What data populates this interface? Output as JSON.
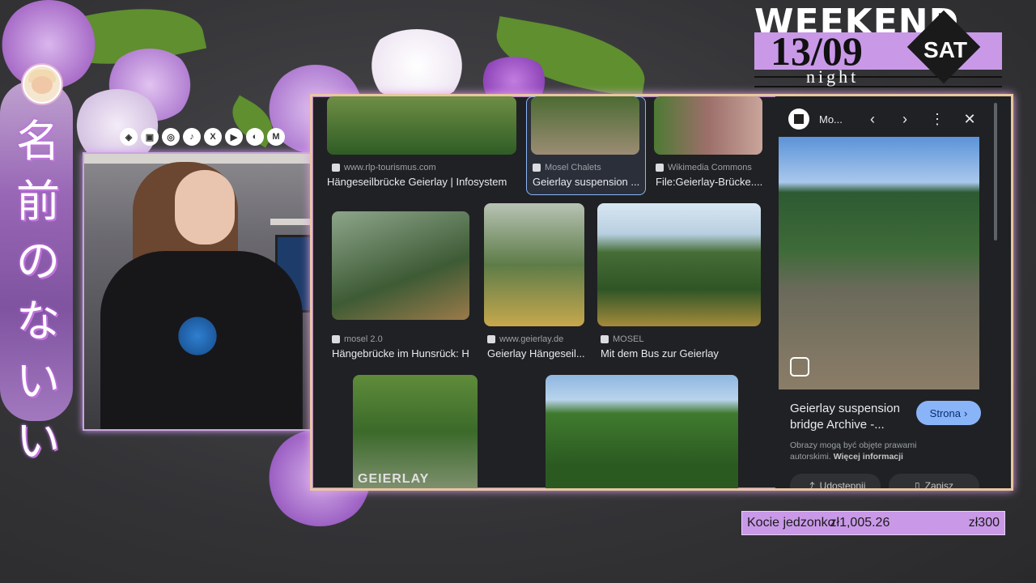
{
  "overlay": {
    "japanese_text": [
      "名",
      "前",
      "の",
      "な",
      "い",
      "い"
    ],
    "social_icons": [
      "streamlabs-icon",
      "twitch-icon",
      "instagram-icon",
      "tiktok-icon",
      "x-icon",
      "youtube-icon",
      "discord-icon",
      "mail-icon"
    ],
    "social_glyphs": [
      "◈",
      "▣",
      "◎",
      "♪",
      "X",
      "▶",
      "◐",
      "M"
    ],
    "weekend": {
      "title": "WEEKEND",
      "date": "13/09",
      "day": "SAT",
      "sub": "night"
    },
    "donation": {
      "label": "Kocie jedzonko",
      "current": "zł1,005.26",
      "goal": "zł300"
    },
    "accent_color": "#c999e8",
    "frame_color": "#e8c7a0"
  },
  "image_results": {
    "row1": [
      {
        "source": "www.rlp-tourismus.com",
        "caption": "Hängeseilbrücke Geierlay | Infosystem"
      },
      {
        "source": "Mosel Chalets",
        "caption": "Geierlay suspension ..."
      },
      {
        "source": "Wikimedia Commons",
        "caption": "File:Geierlay-Brücke...."
      }
    ],
    "row2": [
      {
        "source": "mosel 2.0",
        "caption": "Hängebrücke im Hunsrück: H..."
      },
      {
        "source": "www.geierlay.de",
        "caption": "Geierlay Hängeseil..."
      },
      {
        "source": "MOSEL",
        "caption": "Mit dem Bus zur Geierlay"
      }
    ],
    "row3_watermark": "GEIERLAY"
  },
  "side_panel": {
    "site_name": "Mo...",
    "title": "Geierlay suspension bridge Archive -...",
    "visit_label": "Strona",
    "note": "Obrazy mogą być objęte prawami autorskimi.",
    "note_link": "Więcej informacji",
    "share_label": "Udostępnij",
    "save_label": "Zapisz"
  }
}
